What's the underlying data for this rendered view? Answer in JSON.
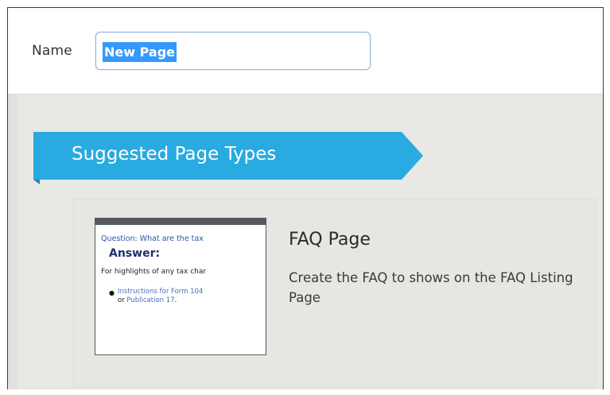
{
  "name_field": {
    "label": "Name",
    "value": "New Page"
  },
  "section": {
    "title": "Suggested Page Types",
    "ribbon_color": "#29aae1"
  },
  "page_types": [
    {
      "title": "FAQ Page",
      "description": "Create the FAQ to shows on the FAQ Listing Page",
      "thumbnail": {
        "question": "Question: What are the tax",
        "answer": "Answer:",
        "highlights": "For highlights of any tax char",
        "link1": "Instructions for Form 104",
        "or_text": "or",
        "link2": "Publication 17",
        "period": "."
      }
    }
  ]
}
